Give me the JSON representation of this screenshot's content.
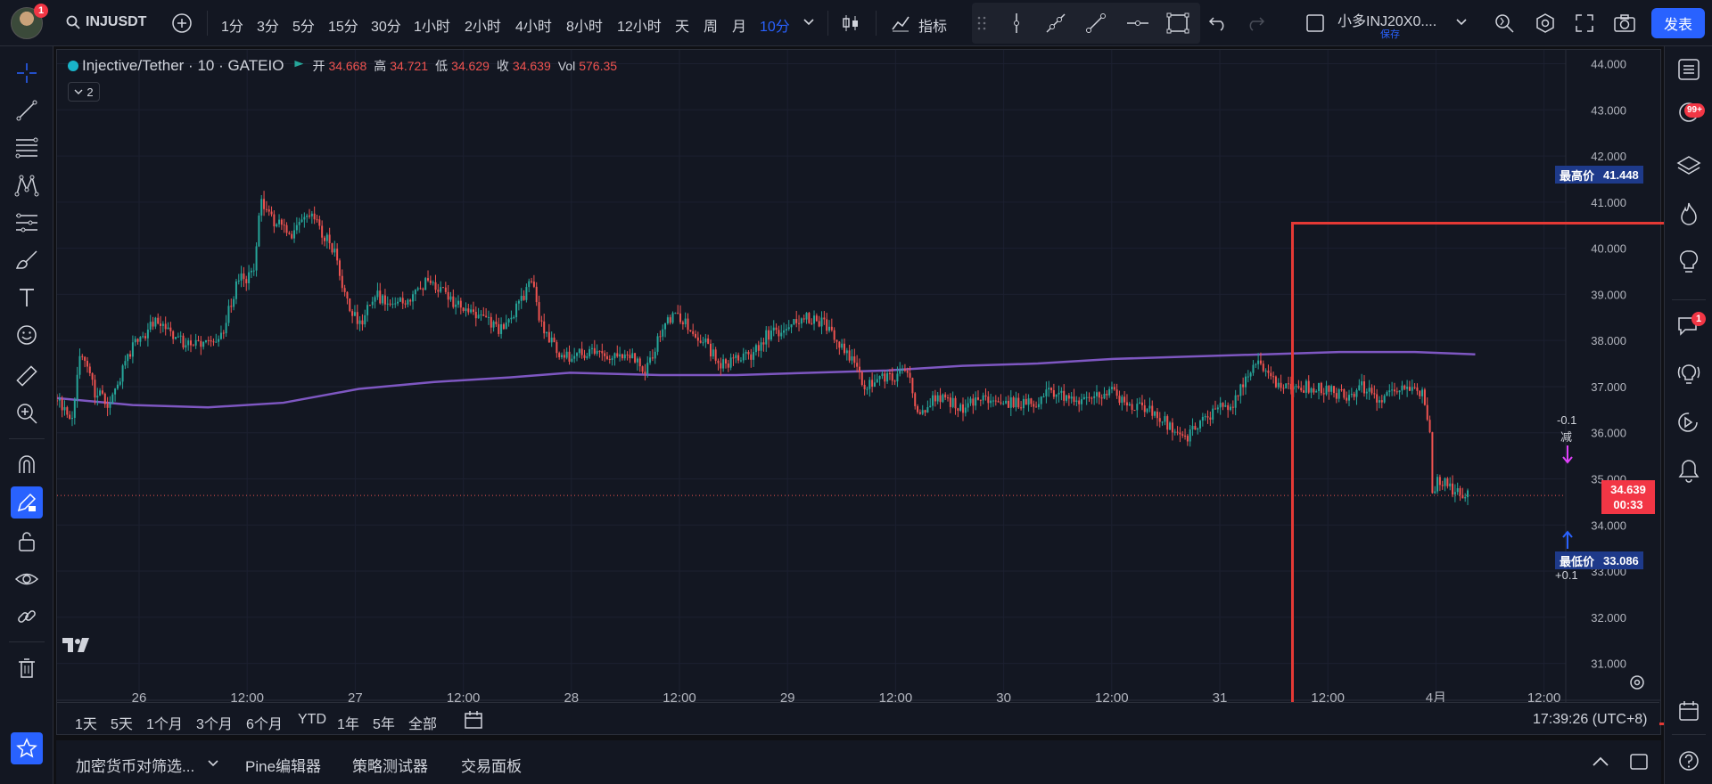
{
  "topbar": {
    "avatar_badge": "1",
    "symbol": "INJUSDT",
    "timeframes": [
      "1分",
      "3分",
      "5分",
      "15分",
      "30分",
      "1小时",
      "2小时",
      "4小时",
      "8小时",
      "12小时",
      "天",
      "周",
      "月",
      "10分"
    ],
    "indicators_label": "指标",
    "layout_name": "小多INJ20X0....",
    "layout_save": "保存",
    "publish_label": "发表"
  },
  "legend": {
    "title": "Injective/Tether · 10 · GATEIO",
    "open_label": "开",
    "open": "34.668",
    "high_label": "高",
    "high": "34.721",
    "low_label": "低",
    "low": "34.629",
    "close_label": "收",
    "close": "34.639",
    "vol_label": "Vol",
    "vol": "576.35",
    "collapse_count": "2"
  },
  "markers": {
    "max_label": "最高价",
    "max_value": "41.448",
    "min_label": "最低价",
    "min_value": "33.086",
    "sell_qty": "-0.1",
    "sell_label": "减",
    "buy_qty": "+0.1",
    "last_price": "34.639",
    "countdown": "00:33"
  },
  "right_badges": {
    "notifications": "99+",
    "chat": "1"
  },
  "bottom": {
    "ranges": [
      "1天",
      "5天",
      "1个月",
      "3个月",
      "6个月",
      "YTD",
      "1年",
      "5年",
      "全部"
    ],
    "clock": "17:39:26 (UTC+8)",
    "panels": [
      "加密货币对筛选...",
      "Pine编辑器",
      "策略测试器",
      "交易面板"
    ]
  },
  "chart_data": {
    "type": "candlestick",
    "symbol": "Injective/Tether",
    "interval": "10",
    "exchange": "GATEIO",
    "y_axis_ticks": [
      "44.000",
      "43.000",
      "42.000",
      "41.000",
      "40.000",
      "39.000",
      "38.000",
      "37.000",
      "36.000",
      "35.000",
      "34.000",
      "33.000",
      "32.000",
      "31.000"
    ],
    "x_axis_ticks": [
      "26",
      "12:00",
      "27",
      "12:00",
      "28",
      "12:00",
      "29",
      "12:00",
      "30",
      "12:00",
      "31",
      "12:00",
      "4月",
      "12:00"
    ],
    "ylim": [
      30.2,
      44.3
    ],
    "price_series": [
      [
        0.0,
        36.7
      ],
      [
        0.01,
        36.35
      ],
      [
        0.015,
        37.8
      ],
      [
        0.025,
        36.9
      ],
      [
        0.035,
        36.6
      ],
      [
        0.05,
        37.9
      ],
      [
        0.065,
        38.4
      ],
      [
        0.08,
        38.0
      ],
      [
        0.095,
        37.9
      ],
      [
        0.11,
        38.2
      ],
      [
        0.12,
        39.3
      ],
      [
        0.13,
        39.4
      ],
      [
        0.135,
        41.1
      ],
      [
        0.142,
        40.6
      ],
      [
        0.155,
        40.3
      ],
      [
        0.165,
        40.8
      ],
      [
        0.175,
        40.4
      ],
      [
        0.185,
        39.9
      ],
      [
        0.19,
        39.0
      ],
      [
        0.2,
        38.3
      ],
      [
        0.21,
        39.0
      ],
      [
        0.22,
        38.8
      ],
      [
        0.235,
        38.9
      ],
      [
        0.245,
        39.3
      ],
      [
        0.26,
        38.9
      ],
      [
        0.27,
        38.6
      ],
      [
        0.28,
        38.6
      ],
      [
        0.295,
        38.2
      ],
      [
        0.305,
        38.7
      ],
      [
        0.315,
        39.3
      ],
      [
        0.32,
        38.4
      ],
      [
        0.33,
        37.8
      ],
      [
        0.34,
        37.6
      ],
      [
        0.355,
        37.8
      ],
      [
        0.365,
        37.7
      ],
      [
        0.38,
        37.7
      ],
      [
        0.39,
        37.3
      ],
      [
        0.4,
        38.2
      ],
      [
        0.41,
        38.6
      ],
      [
        0.42,
        38.2
      ],
      [
        0.43,
        37.9
      ],
      [
        0.44,
        37.5
      ],
      [
        0.45,
        37.6
      ],
      [
        0.46,
        37.7
      ],
      [
        0.47,
        38.1
      ],
      [
        0.48,
        38.2
      ],
      [
        0.49,
        38.4
      ],
      [
        0.5,
        38.5
      ],
      [
        0.51,
        38.3
      ],
      [
        0.52,
        37.8
      ],
      [
        0.53,
        37.5
      ],
      [
        0.535,
        36.9
      ],
      [
        0.545,
        37.2
      ],
      [
        0.555,
        37.2
      ],
      [
        0.565,
        37.3
      ],
      [
        0.57,
        36.4
      ],
      [
        0.58,
        36.7
      ],
      [
        0.59,
        36.7
      ],
      [
        0.6,
        36.5
      ],
      [
        0.61,
        36.8
      ],
      [
        0.62,
        36.6
      ],
      [
        0.635,
        36.7
      ],
      [
        0.645,
        36.6
      ],
      [
        0.66,
        36.9
      ],
      [
        0.67,
        36.7
      ],
      [
        0.685,
        36.7
      ],
      [
        0.7,
        36.9
      ],
      [
        0.71,
        36.6
      ],
      [
        0.72,
        36.6
      ],
      [
        0.73,
        36.4
      ],
      [
        0.74,
        36.0
      ],
      [
        0.748,
        35.8
      ],
      [
        0.755,
        36.2
      ],
      [
        0.77,
        36.5
      ],
      [
        0.78,
        36.6
      ],
      [
        0.785,
        37.0
      ],
      [
        0.795,
        37.5
      ],
      [
        0.8,
        37.4
      ],
      [
        0.805,
        37.1
      ],
      [
        0.815,
        37.0
      ],
      [
        0.83,
        37.0
      ],
      [
        0.845,
        36.9
      ],
      [
        0.855,
        36.8
      ],
      [
        0.865,
        37.0
      ],
      [
        0.875,
        36.7
      ],
      [
        0.885,
        37.0
      ],
      [
        0.895,
        36.9
      ],
      [
        0.905,
        36.8
      ],
      [
        0.91,
        36.1
      ],
      [
        0.912,
        34.4
      ],
      [
        0.915,
        35.0
      ],
      [
        0.925,
        34.8
      ],
      [
        0.935,
        34.64
      ]
    ],
    "ma_series": [
      [
        0.0,
        36.75
      ],
      [
        0.05,
        36.6
      ],
      [
        0.1,
        36.55
      ],
      [
        0.15,
        36.65
      ],
      [
        0.2,
        36.95
      ],
      [
        0.25,
        37.1
      ],
      [
        0.3,
        37.2
      ],
      [
        0.34,
        37.3
      ],
      [
        0.4,
        37.25
      ],
      [
        0.45,
        37.25
      ],
      [
        0.5,
        37.3
      ],
      [
        0.55,
        37.35
      ],
      [
        0.6,
        37.45
      ],
      [
        0.65,
        37.5
      ],
      [
        0.7,
        37.6
      ],
      [
        0.75,
        37.65
      ],
      [
        0.8,
        37.7
      ],
      [
        0.85,
        37.75
      ],
      [
        0.9,
        37.75
      ],
      [
        0.94,
        37.7
      ]
    ],
    "max_price": 41.448,
    "min_price": 33.086,
    "last_price": 34.639,
    "ma_color": "#7e57c2",
    "up_color": "#26a69a",
    "down_color": "#ef5350"
  },
  "colors": {
    "accent": "#2962ff",
    "highlight_box": "#e53935",
    "marker_bg": "#1e3a8a"
  }
}
